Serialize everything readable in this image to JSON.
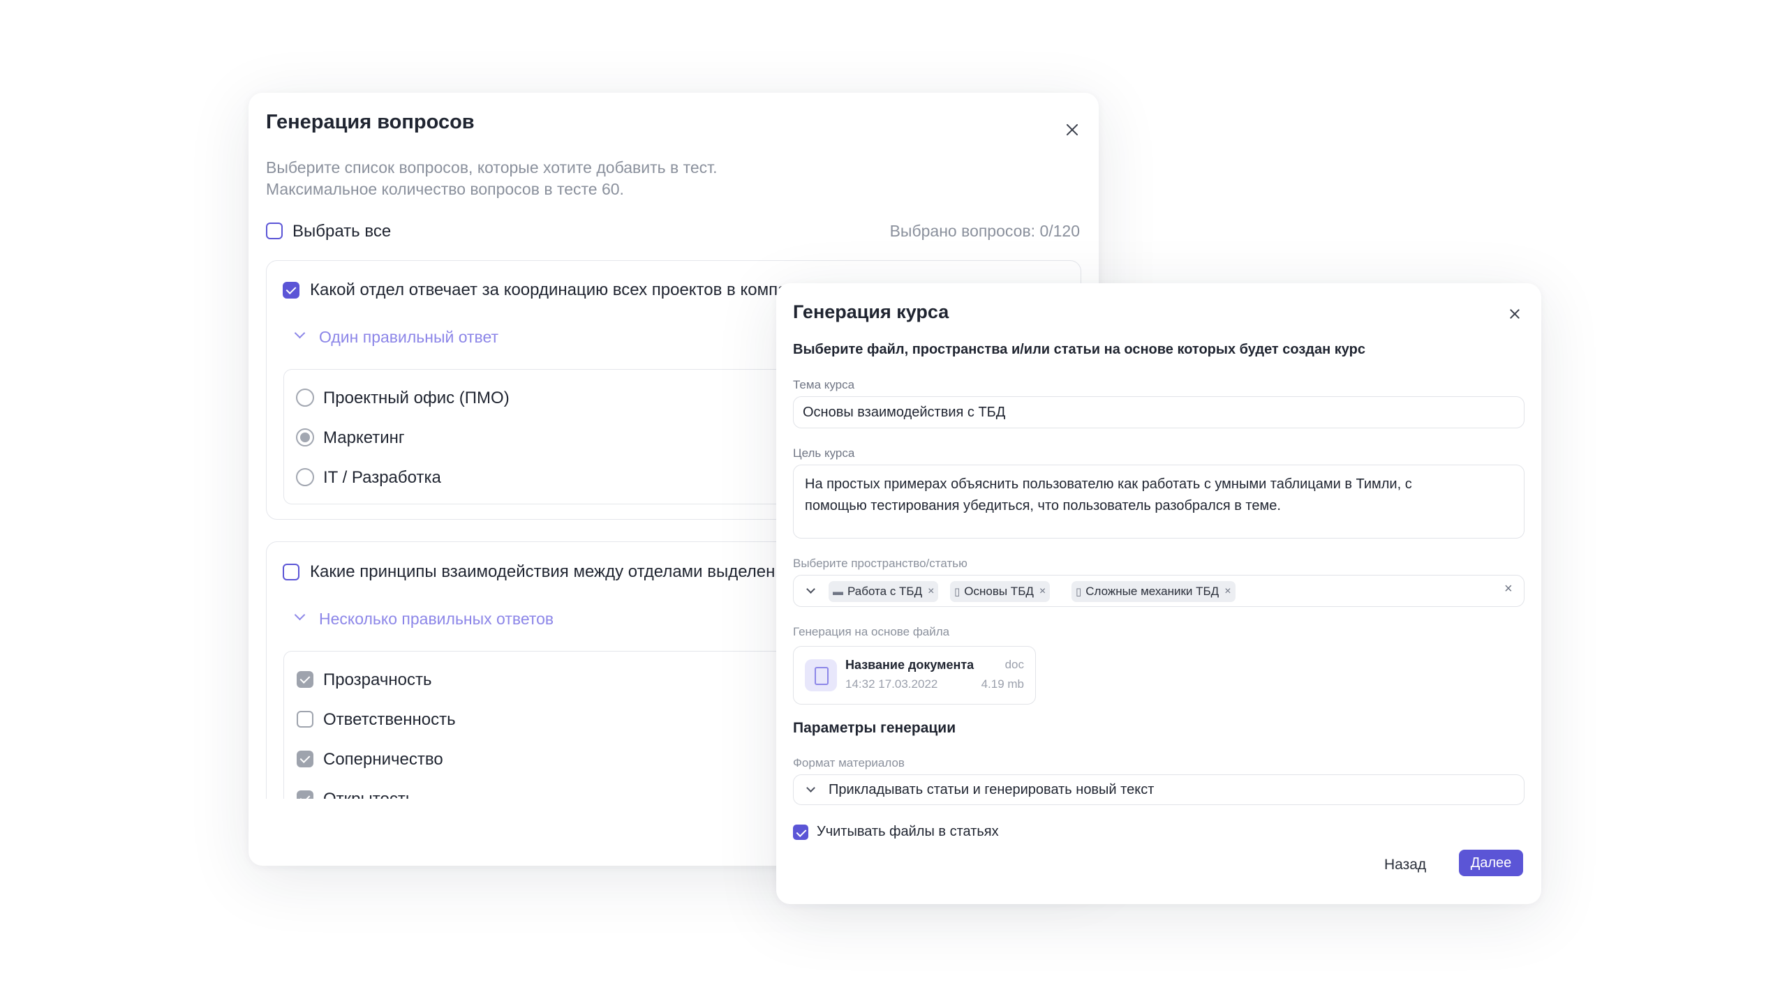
{
  "questions_modal": {
    "title": "Генерация вопросов",
    "description_line1": "Выберите список вопросов, которые хотите добавить в тест.",
    "description_line2": "Максимальное количество вопросов в тесте 60.",
    "select_all_label": "Выбрать все",
    "selected_count": "Выбрано вопросов: 0/120",
    "questions": [
      {
        "text": "Какой отдел отвечает за координацию всех проектов в компании?",
        "checked": true,
        "answer_type": "Один правильный ответ",
        "options": [
          "Проектный офис (ПМО)",
          "Маркетинг",
          "IT / Разработка"
        ]
      },
      {
        "text": "Какие принципы взаимодействия между отделами выделены?",
        "checked": false,
        "answer_type": "Несколько правильных ответов",
        "options": [
          "Прозрачность",
          "Ответственность",
          "Соперничество",
          "Открытость"
        ]
      }
    ]
  },
  "course_modal": {
    "title": "Генерация курса",
    "subtitle": "Выберите файл, пространства и/или статьи на основе которых будет создан курс",
    "topic_label": "Тема курса",
    "topic_value": "Основы взаимодействия с ТБД",
    "goal_label": "Цель курса",
    "goal_line1": "На простых примерах объяснить пользователю как работать с умными таблицами в Тимли, с",
    "goal_line2": "помощью тестирования убедиться, что пользователь разобрался в теме.",
    "spaces_label": "Выберите пространство/статью",
    "tags": [
      "Работа с ТБД",
      "Основы ТБД",
      "Сложные механики ТБД"
    ],
    "file_label": "Генерация на основе файла",
    "file": {
      "name": "Название документа",
      "ext": "doc",
      "date": "14:32 17.03.2022",
      "size": "4.19 mb"
    },
    "params_title": "Параметры генерации",
    "format_label": "Формат материалов",
    "format_value": "Прикладывать статьи и генерировать новый текст",
    "consider_files_label": "Учитывать файлы в статьях",
    "back_button": "Назад",
    "next_button": "Далее"
  }
}
